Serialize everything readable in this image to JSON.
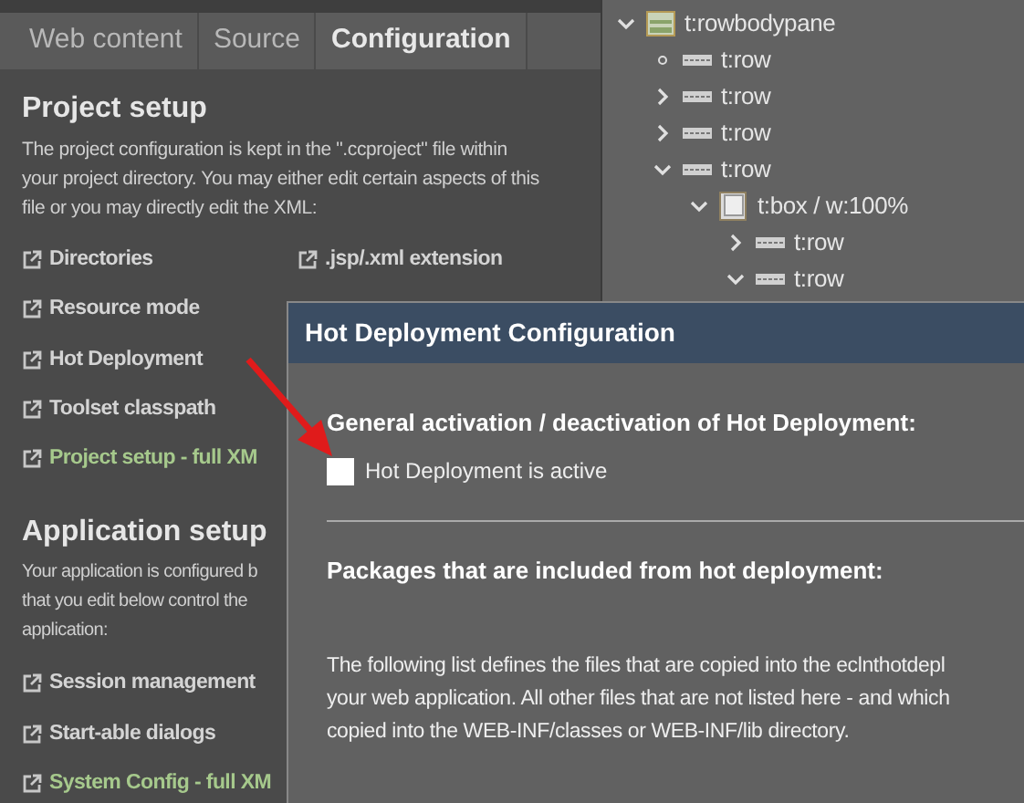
{
  "tabs": [
    {
      "label": "Web content",
      "selected": false
    },
    {
      "label": "Source",
      "selected": false
    },
    {
      "label": "Configuration",
      "selected": true
    }
  ],
  "project_setup": {
    "title": "Project setup",
    "description_lines": [
      "The project configuration is kept in the \".ccproject\" file within",
      "your project directory. You may either edit certain aspects of this",
      "file or you may directly edit the XML:"
    ],
    "links_left": [
      {
        "label": "Directories",
        "kind": "page"
      },
      {
        "label": "Resource mode",
        "kind": "page"
      },
      {
        "label": "Hot Deployment",
        "kind": "page"
      },
      {
        "label": "Toolset classpath",
        "kind": "page"
      },
      {
        "label": "Project setup - full XM",
        "kind": "xml"
      }
    ],
    "links_right": [
      {
        "label": ".jsp/.xml extension",
        "kind": "page"
      }
    ]
  },
  "application_setup": {
    "title": "Application setup",
    "description_lines": [
      "Your application is configured b",
      "that you edit below control the",
      "application:"
    ],
    "links": [
      {
        "label": "Session management",
        "kind": "page"
      },
      {
        "label": "Start-able dialogs",
        "kind": "page"
      },
      {
        "label": "System Config - full XM",
        "kind": "xml"
      }
    ]
  },
  "tree": [
    {
      "label": "t:rowbodypane",
      "kind": "pane",
      "leaf": false,
      "expanded": true,
      "children": [
        {
          "label": "t:row",
          "kind": "row",
          "leaf": true
        },
        {
          "label": "t:row",
          "kind": "row",
          "leaf": false,
          "expanded": false
        },
        {
          "label": "t:row",
          "kind": "row",
          "leaf": false,
          "expanded": false
        },
        {
          "label": "t:row",
          "kind": "row",
          "leaf": false,
          "expanded": true,
          "children": [
            {
              "label": "t:box / w:100%",
              "kind": "box",
              "leaf": false,
              "expanded": true,
              "children": [
                {
                  "label": "t:row",
                  "kind": "row",
                  "leaf": false,
                  "expanded": false
                },
                {
                  "label": "t:row",
                  "kind": "row",
                  "leaf": false,
                  "expanded": true
                }
              ]
            }
          ]
        }
      ]
    }
  ],
  "dialog": {
    "title": "Hot Deployment Configuration",
    "activation_heading": "General activation / deactivation of Hot Deployment:",
    "checkbox": {
      "label": "Hot Deployment is active",
      "checked": false
    },
    "packages_heading": "Packages that are included from hot deployment:",
    "description_lines": [
      "The following list defines the files that are copied into the eclnthotdepl",
      "your web application. All other files that are not listed here - and which",
      "copied into the WEB-INF/classes or WEB-INF/lib directory."
    ]
  }
}
